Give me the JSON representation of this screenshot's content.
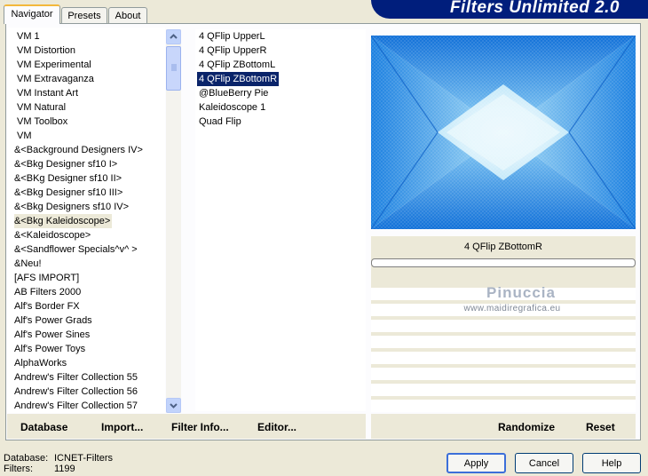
{
  "tabs": [
    "Navigator",
    "Presets",
    "About"
  ],
  "banner_title": "Filters Unlimited 2.0",
  "categories": [
    "VM 1",
    "VM Distortion",
    "VM Experimental",
    "VM Extravaganza",
    "VM Instant Art",
    "VM Natural",
    "VM Toolbox",
    "VM",
    "&<Background Designers IV>",
    "&<Bkg Designer sf10 I>",
    "&<BKg Designer sf10 II>",
    "&<Bkg Designer sf10 III>",
    "&<Bkg Designers sf10 IV>",
    "&<Bkg Kaleidoscope>",
    "&<Kaleidoscope>",
    "&<Sandflower Specials^v^ >",
    "&Neu!",
    "[AFS IMPORT]",
    "AB Filters 2000",
    "Alf's Border FX",
    "Alf's Power Grads",
    "Alf's Power Sines",
    "Alf's Power Toys",
    "AlphaWorks",
    "Andrew's Filter Collection 55",
    "Andrew's Filter Collection 56",
    "Andrew's Filter Collection 57"
  ],
  "selected_category": "&<Bkg Kaleidoscope>",
  "filters": [
    "4 QFlip UpperL",
    "4 QFlip UpperR",
    "4 QFlip ZBottomL",
    "4 QFlip ZBottomR",
    "@BlueBerry Pie",
    "Kaleidoscope 1",
    "Quad Flip"
  ],
  "selected_filter": "4 QFlip ZBottomR",
  "preview_label": "4 QFlip ZBottomR",
  "watermark": {
    "name": "Pinuccia",
    "url": "www.maidiregrafica.eu"
  },
  "bottom_links": {
    "database": "Database",
    "import": "Import...",
    "filter_info": "Filter Info...",
    "editor": "Editor...",
    "randomize": "Randomize",
    "reset": "Reset"
  },
  "buttons": {
    "apply": "Apply",
    "cancel": "Cancel",
    "help": "Help"
  },
  "status": {
    "database_label": "Database:",
    "database_value": "ICNET-Filters",
    "filters_label": "Filters:",
    "filters_value": "1199"
  },
  "colors": {
    "banner_bg": "#001e7c",
    "selection": "#0a246a",
    "preview_blue": "#1a8ce8",
    "preview_light": "#dff4fb"
  },
  "icons": {
    "scroll_up": "chevron-up-icon",
    "scroll_down": "chevron-down-icon"
  }
}
